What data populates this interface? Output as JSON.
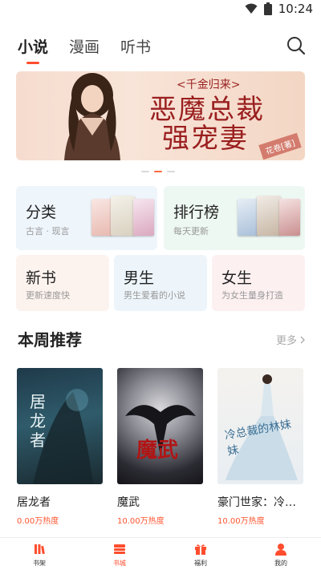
{
  "status_bar": {
    "time": "10:24"
  },
  "top_tabs": [
    {
      "label": "小说",
      "active": true
    },
    {
      "label": "漫画",
      "active": false
    },
    {
      "label": "听书",
      "active": false
    }
  ],
  "banner": {
    "subtitle": "<千金归来>",
    "title_line1": "恶魔总裁",
    "title_line2": "强宠妻",
    "author": "花卷[著]"
  },
  "carousel": {
    "total": 3,
    "active_index": 1
  },
  "categories": {
    "fenlei": {
      "title": "分类",
      "subtitle": "古言 · 现言"
    },
    "paihang": {
      "title": "排行榜",
      "subtitle": "每天更新"
    },
    "xinshu": {
      "title": "新书",
      "subtitle": "更新速度快"
    },
    "nansheng": {
      "title": "男生",
      "subtitle": "男生爱看的小说"
    },
    "nvsheng": {
      "title": "女生",
      "subtitle": "为女生量身打造"
    }
  },
  "weekly": {
    "title": "本周推荐",
    "more": "更多",
    "books": [
      {
        "name": "居龙者",
        "heat": "0.00万热度",
        "cover_text": "居龙者"
      },
      {
        "name": "魔武",
        "heat": "10.00万热度",
        "cover_text": "魔武"
      },
      {
        "name": "豪门世家：冷…",
        "heat": "10.00万热度",
        "cover_text": "冷总裁的林妹妹"
      }
    ]
  },
  "bottom_nav": [
    {
      "label": "书架",
      "icon": "bookshelf-icon",
      "active": false
    },
    {
      "label": "书城",
      "icon": "bookstore-icon",
      "active": true
    },
    {
      "label": "福利",
      "icon": "gift-icon",
      "active": false
    },
    {
      "label": "我的",
      "icon": "profile-icon",
      "active": false
    }
  ],
  "colors": {
    "accent": "#ff4d2d",
    "muted": "#999999"
  }
}
